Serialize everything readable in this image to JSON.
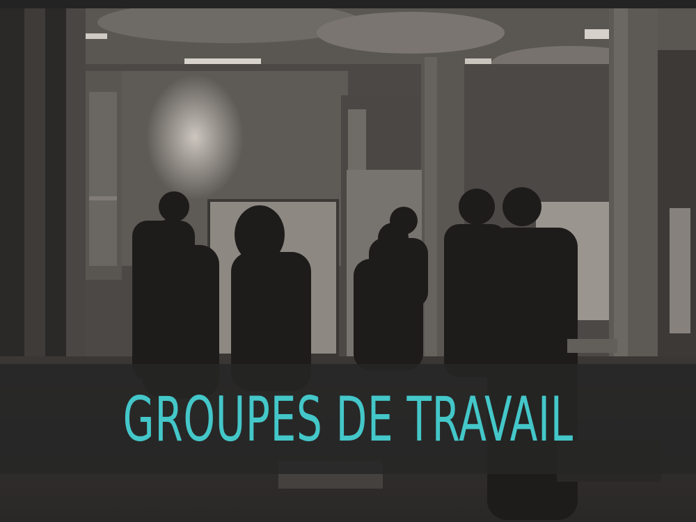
{
  "banner": {
    "title": "GROUPES DE TRAVAIL",
    "title_color": "#44c7c9"
  }
}
